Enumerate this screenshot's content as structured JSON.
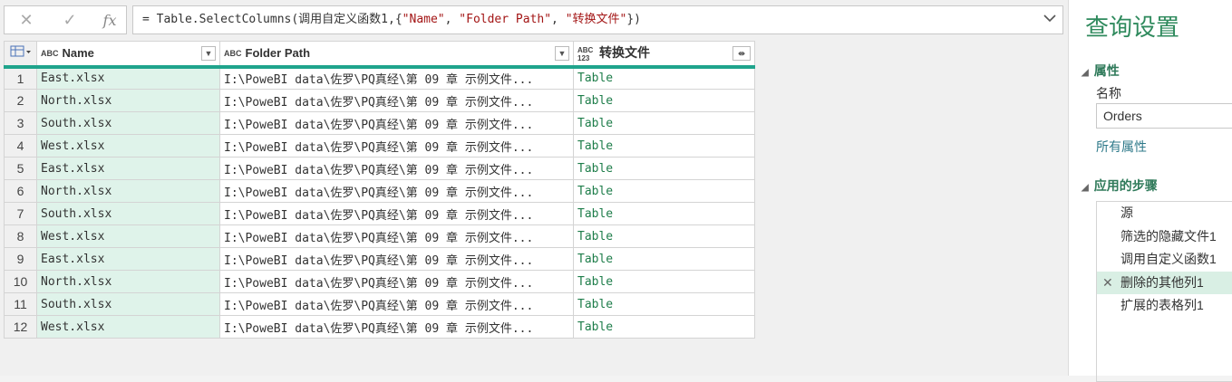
{
  "formula_bar": {
    "cancel_icon": "✕",
    "confirm_icon": "✓",
    "fx_label": "fx",
    "formula_prefix": "= Table.SelectColumns(调用自定义函数1,{",
    "formula_args": [
      "\"Name\"",
      "\"Folder Path\"",
      "\"转换文件\""
    ],
    "formula_suffix": "})"
  },
  "grid": {
    "columns": [
      {
        "type_icon": "ABC",
        "label": "Name"
      },
      {
        "type_icon": "ABC",
        "label": "Folder Path"
      },
      {
        "type_icon": "ABC 123",
        "label": "转换文件"
      }
    ],
    "rows": [
      {
        "n": "1",
        "name": "East.xlsx",
        "path": "I:\\PoweBI data\\佐罗\\PQ真经\\第 09 章 示例文件...",
        "val": "Table"
      },
      {
        "n": "2",
        "name": "North.xlsx",
        "path": "I:\\PoweBI data\\佐罗\\PQ真经\\第 09 章 示例文件...",
        "val": "Table"
      },
      {
        "n": "3",
        "name": "South.xlsx",
        "path": "I:\\PoweBI data\\佐罗\\PQ真经\\第 09 章 示例文件...",
        "val": "Table"
      },
      {
        "n": "4",
        "name": "West.xlsx",
        "path": "I:\\PoweBI data\\佐罗\\PQ真经\\第 09 章 示例文件...",
        "val": "Table"
      },
      {
        "n": "5",
        "name": "East.xlsx",
        "path": "I:\\PoweBI data\\佐罗\\PQ真经\\第 09 章 示例文件...",
        "val": "Table"
      },
      {
        "n": "6",
        "name": "North.xlsx",
        "path": "I:\\PoweBI data\\佐罗\\PQ真经\\第 09 章 示例文件...",
        "val": "Table"
      },
      {
        "n": "7",
        "name": "South.xlsx",
        "path": "I:\\PoweBI data\\佐罗\\PQ真经\\第 09 章 示例文件...",
        "val": "Table"
      },
      {
        "n": "8",
        "name": "West.xlsx",
        "path": "I:\\PoweBI data\\佐罗\\PQ真经\\第 09 章 示例文件...",
        "val": "Table"
      },
      {
        "n": "9",
        "name": "East.xlsx",
        "path": "I:\\PoweBI data\\佐罗\\PQ真经\\第 09 章 示例文件...",
        "val": "Table"
      },
      {
        "n": "10",
        "name": "North.xlsx",
        "path": "I:\\PoweBI data\\佐罗\\PQ真经\\第 09 章 示例文件...",
        "val": "Table"
      },
      {
        "n": "11",
        "name": "South.xlsx",
        "path": "I:\\PoweBI data\\佐罗\\PQ真经\\第 09 章 示例文件...",
        "val": "Table"
      },
      {
        "n": "12",
        "name": "West.xlsx",
        "path": "I:\\PoweBI data\\佐罗\\PQ真经\\第 09 章 示例文件...",
        "val": "Table"
      }
    ]
  },
  "pane": {
    "title": "查询设置",
    "properties_heading": "属性",
    "name_label": "名称",
    "name_value": "Orders",
    "all_properties_link": "所有属性",
    "steps_heading": "应用的步骤",
    "steps": [
      "源",
      "筛选的隐藏文件1",
      "调用自定义函数1",
      "删除的其他列1",
      "扩展的表格列1"
    ],
    "selected_step_index": 3
  },
  "colors": {
    "accent": "#1fa48c",
    "name_col_bg": "#dff3ea",
    "table_value": "#1e7d4a",
    "title": "#2f8a5d"
  }
}
